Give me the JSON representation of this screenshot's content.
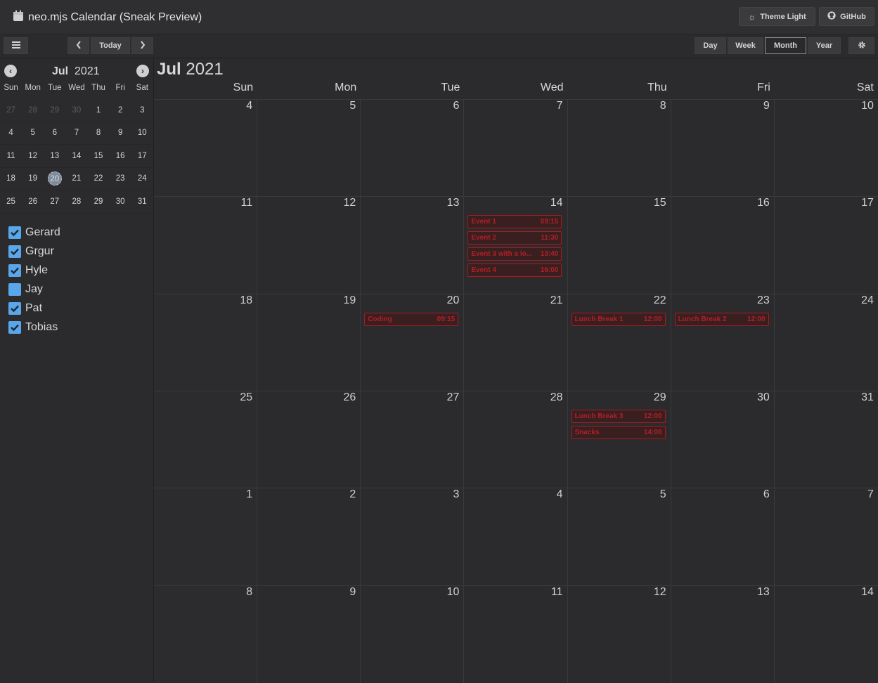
{
  "header": {
    "title": "neo.mjs Calendar (Sneak Preview)",
    "theme_button": "Theme Light",
    "github_button": "GitHub"
  },
  "toolbar": {
    "menu_icon": "hamburger-icon",
    "today_label": "Today",
    "views": [
      "Day",
      "Week",
      "Month",
      "Year"
    ],
    "active_view": "Month"
  },
  "mini_calendar": {
    "month": "Jul",
    "year": "2021",
    "days_of_week": [
      "Sun",
      "Mon",
      "Tue",
      "Wed",
      "Thu",
      "Fri",
      "Sat"
    ],
    "weeks": [
      [
        "27",
        "28",
        "29",
        "30",
        "1",
        "2",
        "3"
      ],
      [
        "4",
        "5",
        "6",
        "7",
        "8",
        "9",
        "10"
      ],
      [
        "11",
        "12",
        "13",
        "14",
        "15",
        "16",
        "17"
      ],
      [
        "18",
        "19",
        "20",
        "21",
        "22",
        "23",
        "24"
      ],
      [
        "25",
        "26",
        "27",
        "28",
        "29",
        "30",
        "31"
      ]
    ],
    "today": "20"
  },
  "calendars": [
    {
      "name": "Gerard",
      "checked": true
    },
    {
      "name": "Grgur",
      "checked": true
    },
    {
      "name": "Hyle",
      "checked": true
    },
    {
      "name": "Jay",
      "checked": false
    },
    {
      "name": "Pat",
      "checked": true
    },
    {
      "name": "Tobias",
      "checked": true
    }
  ],
  "month_view": {
    "month": "Jul",
    "year": "2021",
    "days_of_week": [
      "Sun",
      "Mon",
      "Tue",
      "Wed",
      "Thu",
      "Fri",
      "Sat"
    ],
    "weeks": [
      [
        "4",
        "5",
        "6",
        "7",
        "8",
        "9",
        "10"
      ],
      [
        "11",
        "12",
        "13",
        "14",
        "15",
        "16",
        "17"
      ],
      [
        "18",
        "19",
        "20",
        "21",
        "22",
        "23",
        "24"
      ],
      [
        "25",
        "26",
        "27",
        "28",
        "29",
        "30",
        "31"
      ],
      [
        "1",
        "2",
        "3",
        "4",
        "5",
        "6",
        "7"
      ],
      [
        "8",
        "9",
        "10",
        "11",
        "12",
        "13",
        "14"
      ]
    ],
    "events": [
      {
        "week": 1,
        "day": 3,
        "title": "Event 1",
        "time": "09:15"
      },
      {
        "week": 1,
        "day": 3,
        "title": "Event 2",
        "time": "11:30"
      },
      {
        "week": 1,
        "day": 3,
        "title": "Event 3 with a lo...",
        "time": "13:40"
      },
      {
        "week": 1,
        "day": 3,
        "title": "Event 4",
        "time": "16:00"
      },
      {
        "week": 2,
        "day": 2,
        "title": "Coding",
        "time": "09:15"
      },
      {
        "week": 2,
        "day": 4,
        "title": "Lunch Break 1",
        "time": "12:00"
      },
      {
        "week": 2,
        "day": 5,
        "title": "Lunch Break 2",
        "time": "12:00"
      },
      {
        "week": 3,
        "day": 4,
        "title": "Lunch Break 3",
        "time": "12:00"
      },
      {
        "week": 3,
        "day": 4,
        "title": "Snacks",
        "time": "14:00"
      }
    ]
  },
  "colors": {
    "event_border": "#a41c20",
    "checkbox": "#5aa6ea",
    "background": "#2b2b2d"
  }
}
